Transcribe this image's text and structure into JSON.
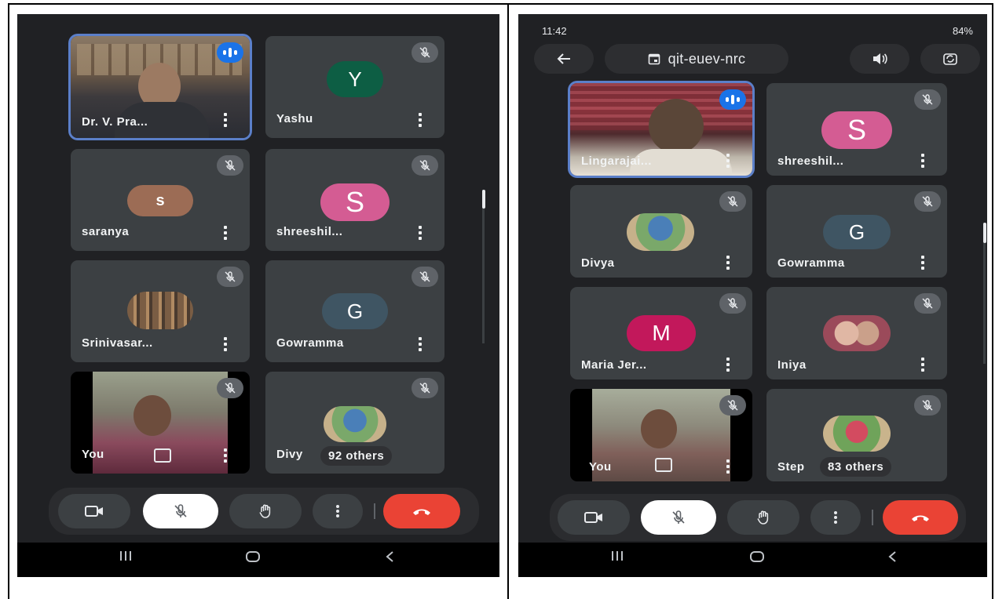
{
  "left": {
    "tiles": [
      {
        "name": "Dr. V. Pra...",
        "type": "video",
        "speaking": true
      },
      {
        "name": "Yashu",
        "initial": "Y",
        "avatar_color": "#0d5e44"
      },
      {
        "name": "saranya",
        "initial": "s",
        "avatar_color": "#9c6c55"
      },
      {
        "name": "shreeshil...",
        "initial": "S",
        "avatar_color": "#d45c93"
      },
      {
        "name": "Srinivasar...",
        "type": "photo-avatar"
      },
      {
        "name": "Gowramma",
        "initial": "G",
        "avatar_color": "#3f5563"
      },
      {
        "name": "You",
        "type": "video-self"
      },
      {
        "name": "Divy",
        "type": "photo-avatar",
        "others": "92 others"
      }
    ]
  },
  "right": {
    "status": {
      "time": "11:42",
      "right": "84%"
    },
    "meeting_code": "qit-euev-nrc",
    "tiles": [
      {
        "name": "Lingarajai...",
        "type": "video",
        "speaking": true
      },
      {
        "name": "shreeshil...",
        "initial": "S",
        "avatar_color": "#d45c93"
      },
      {
        "name": "Divya",
        "type": "photo-avatar"
      },
      {
        "name": "Gowramma",
        "initial": "G",
        "avatar_color": "#3f5563"
      },
      {
        "name": "Maria Jer...",
        "initial": "M",
        "avatar_color": "#c2185b"
      },
      {
        "name": "Iniya",
        "type": "photo-avatar"
      },
      {
        "name": "You",
        "type": "video-self"
      },
      {
        "name": "Step",
        "type": "photo-avatar",
        "others": "83 others"
      }
    ]
  },
  "controls": [
    "camera-toggle",
    "mic-toggle",
    "raise-hand",
    "more-options",
    "leave-call"
  ],
  "colors": {
    "background": "#202124",
    "tile": "#3c4043",
    "leave": "#ea4335",
    "speaking": "#1a73e8"
  }
}
